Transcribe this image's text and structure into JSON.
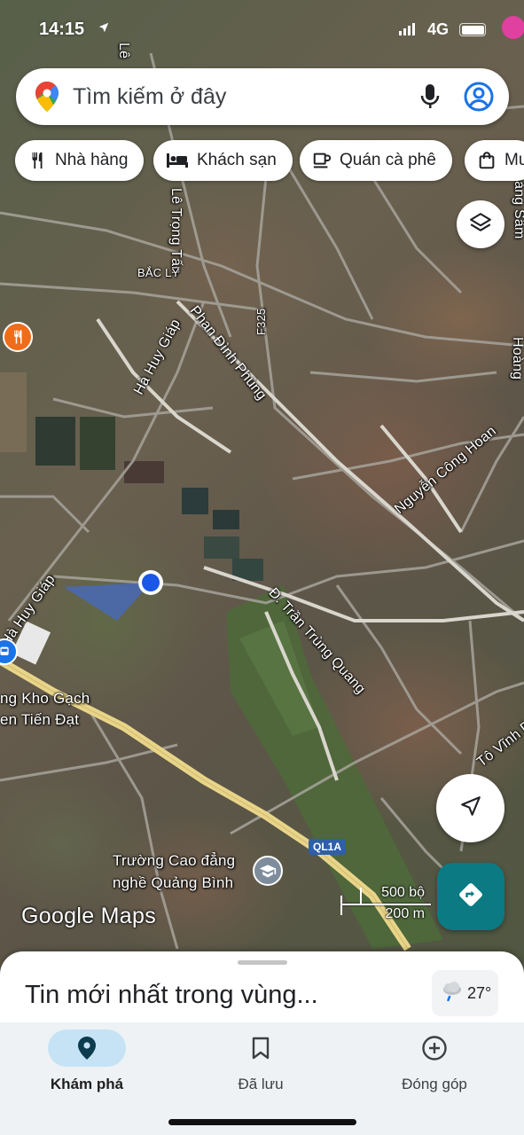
{
  "status_bar": {
    "time": "14:15",
    "network": "4G",
    "icons": [
      "location-arrow-icon",
      "signal-icon",
      "battery-icon"
    ]
  },
  "search": {
    "placeholder": "Tìm kiếm ở đây",
    "icons": [
      "google-maps-pin-icon",
      "microphone-icon",
      "account-icon"
    ]
  },
  "chips": [
    {
      "label": "Nhà hàng",
      "icon": "restaurant-icon"
    },
    {
      "label": "Khách sạn",
      "icon": "hotel-icon"
    },
    {
      "label": "Quán cà phê",
      "icon": "coffee-icon"
    },
    {
      "label": "Mu",
      "icon": "shopping-bag-icon"
    }
  ],
  "map": {
    "labels": {
      "le_top": "Lê",
      "le_trong_tan": "Lê Trọng Tấn",
      "bac_ly": "BẮC LÝ",
      "f325": "F325",
      "phan_dinh_phung": "Phan Đình Phùng",
      "ha_huy_giap": "Hà Huy Giáp",
      "ha_huy_giap_2": "Hà Huy Giáp",
      "hoang_sam": "oàng Sâm",
      "hoang": "Hoàng",
      "nguyen_cong_hoan": "Nguyễn Công Hoan",
      "tran_trung_quang": "Đ. Trần Trùng Quang",
      "to_vinh_dien": "Tô Vĩnh Diện",
      "kho_gach": "ng Kho Gạch",
      "tien_dat": "en Tiến Đạt",
      "truong_line1": "Trường Cao đẳng",
      "truong_line2": "nghề Quảng Bình"
    },
    "route_shield": "QL1A",
    "attribution": "Google Maps",
    "scale": {
      "top": "500 bộ",
      "bottom": "200 m"
    }
  },
  "sheet": {
    "title": "Tin mới nhất trong vùng...",
    "weather": {
      "temp": "27°",
      "icon": "cloud-rain-icon"
    }
  },
  "nav": [
    {
      "label": "Khám phá",
      "icon": "explore-pin-icon",
      "active": true
    },
    {
      "label": "Đã lưu",
      "icon": "bookmark-icon",
      "active": false
    },
    {
      "label": "Đóng góp",
      "icon": "add-circle-icon",
      "active": false
    }
  ],
  "colors": {
    "accent": "#1a73e8",
    "directions_fab": "#0b7a83",
    "nav_active_pill": "#c6e3f5",
    "main_road": "#e8d58a",
    "location_dot": "#1a57e8"
  }
}
